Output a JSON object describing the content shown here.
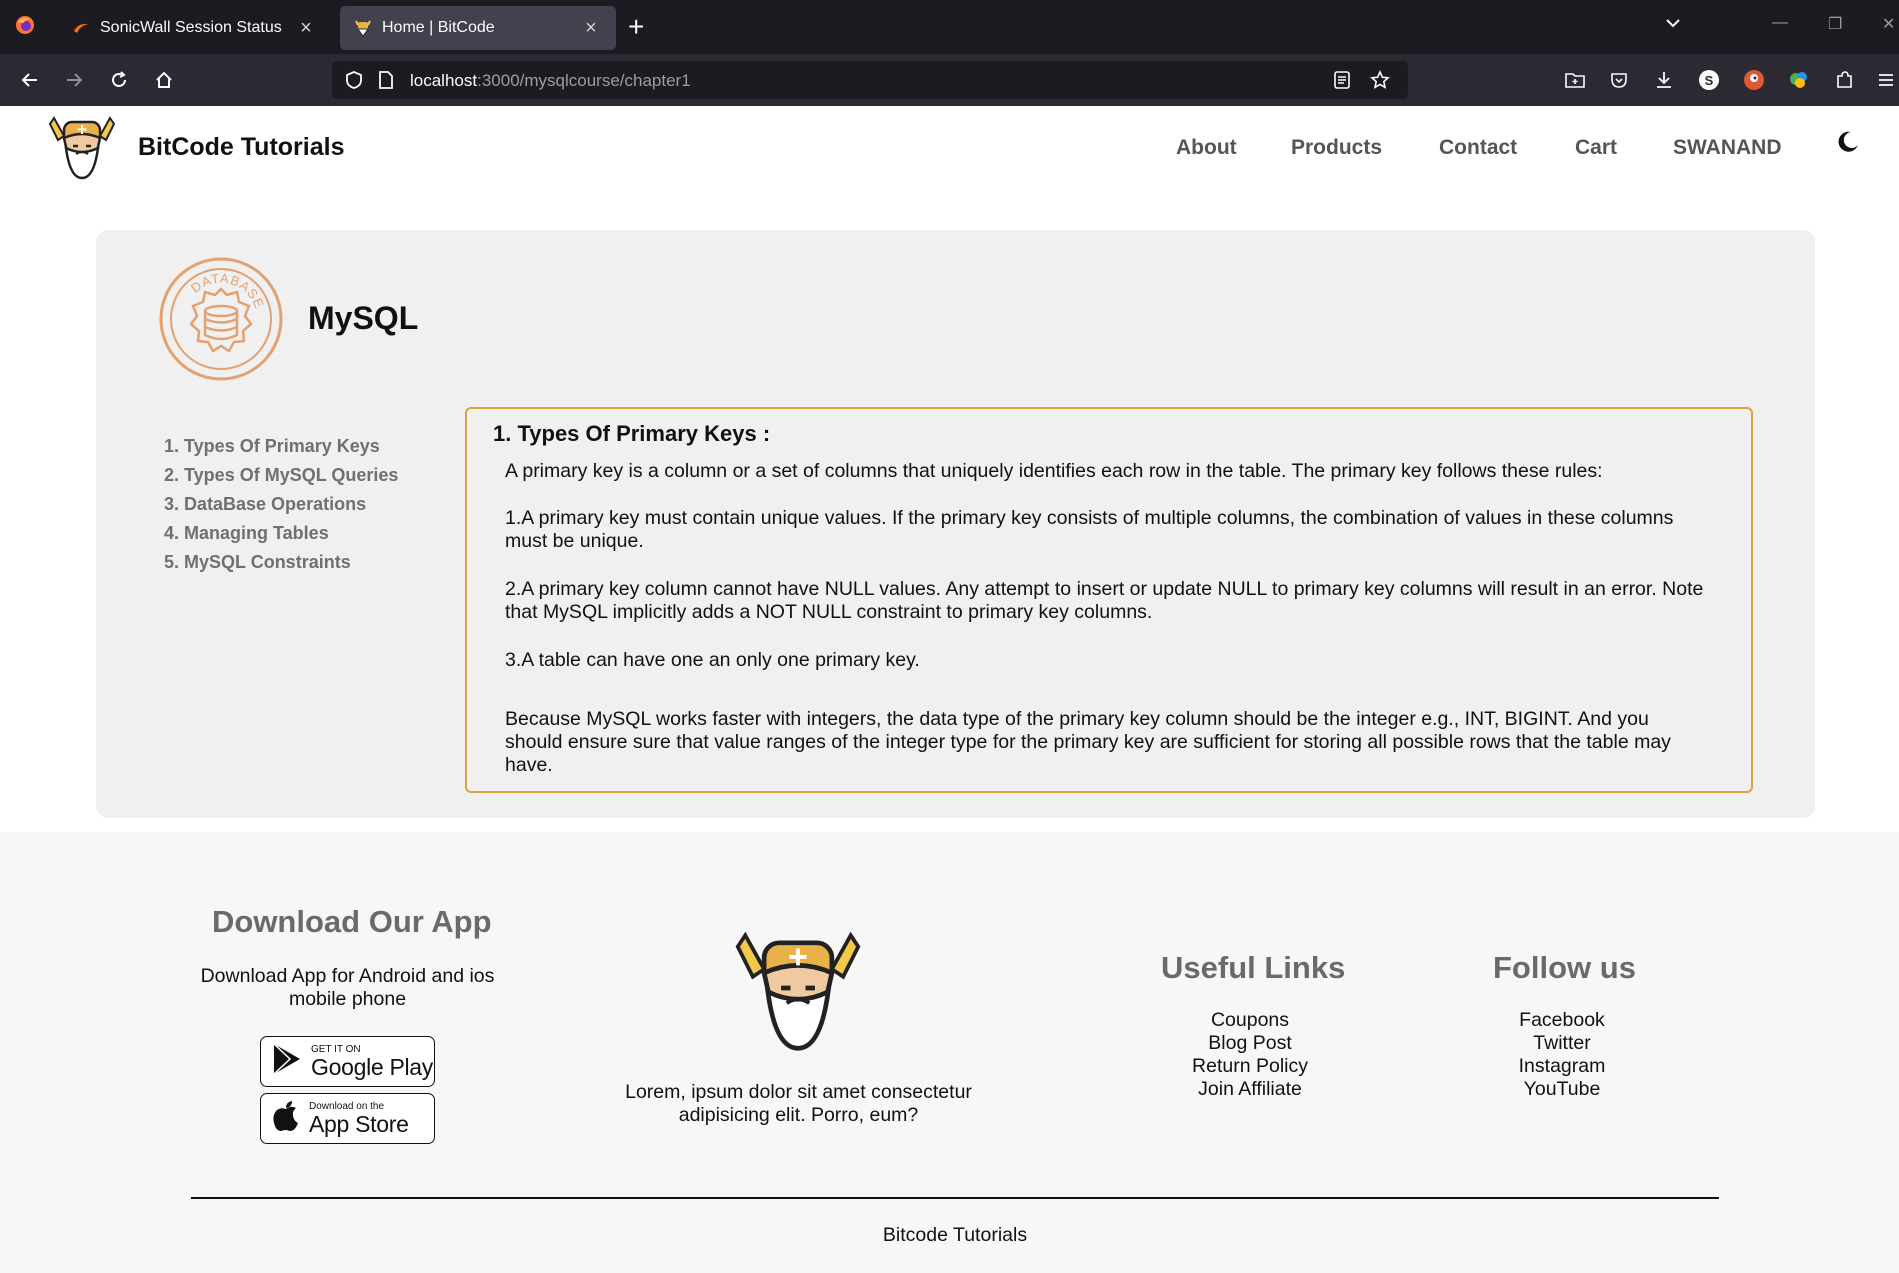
{
  "browser": {
    "tabs": [
      {
        "title": "SonicWall Session Status",
        "active": false
      },
      {
        "title": "Home | BitCode",
        "active": true
      }
    ],
    "url_host": "localhost",
    "url_path": ":3000/mysqlcourse/chapter1",
    "icons": [
      "back-arrow-icon",
      "forward-arrow-icon",
      "reload-icon",
      "home-icon",
      "shield-icon",
      "page-icon",
      "reader-view-icon",
      "bookmark-star-icon",
      "save-to-collection-icon",
      "pocket-icon",
      "download-icon",
      "extension-s-icon",
      "duckduckgo-icon",
      "color-extension-icon",
      "extensions-puzzle-icon",
      "menu-icon"
    ]
  },
  "site": {
    "brand": "BitCode Tutorials",
    "nav": [
      "About",
      "Products",
      "Contact",
      "Cart",
      "SWANAND"
    ],
    "theme_icon": "moon-icon"
  },
  "course": {
    "logo_text": "DATABASE",
    "title": "MySQL",
    "chapters": [
      "1. Types Of Primary Keys",
      "2. Types Of MySQL Queries",
      "3. DataBase Operations",
      "4. Managing Tables",
      "5. MySQL Constraints"
    ],
    "content": {
      "heading": "1. Types Of Primary Keys :",
      "intro": "A primary key is a column or a set of columns that uniquely identifies each row in the table. The primary key follows these rules:",
      "rule1": "1.A primary key must contain unique values. If the primary key consists of multiple columns, the combination of values in these columns must be unique.",
      "rule2": "2.A primary key column cannot have NULL values. Any attempt to insert or update NULL to primary key columns will result in an error. Note that MySQL implicitly adds a NOT NULL constraint to primary key columns.",
      "rule3": "3.A table can have one an only one primary key.",
      "note": "Because MySQL works faster with integers, the data type of the primary key column should be the integer e.g., INT, BIGINT. And you should ensure sure that value ranges of the integer type for the primary key are sufficient for storing all possible rows that the table may have."
    }
  },
  "footer": {
    "app_heading": "Download Our App",
    "app_desc": "Download App for Android and ios mobile phone",
    "google_play": {
      "small": "GET IT ON",
      "big": "Google Play"
    },
    "app_store": {
      "small": "Download on the",
      "big": "App Store"
    },
    "lorem": "Lorem, ipsum dolor sit amet consectetur adipisicing elit. Porro, eum?",
    "useful_heading": "Useful Links",
    "useful_links": [
      "Coupons",
      "Blog Post",
      "Return Policy",
      "Join Affiliate"
    ],
    "follow_heading": "Follow us",
    "follow_links": [
      "Facebook",
      "Twitter",
      "Instagram",
      "YouTube"
    ],
    "copyright": "Bitcode Tutorials"
  }
}
